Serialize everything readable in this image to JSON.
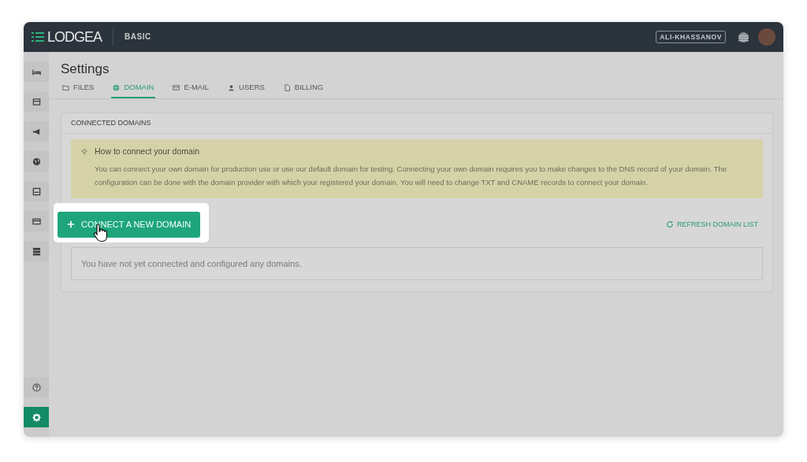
{
  "header": {
    "logo": "LODGEA",
    "plan": "BASIC",
    "user": "ALI-KHASSANOV"
  },
  "sidebar": {
    "items": [
      {
        "selected": false
      },
      {
        "selected": false
      },
      {
        "selected": false
      },
      {
        "selected": false
      },
      {
        "selected": false
      },
      {
        "selected": false
      },
      {
        "selected": false
      }
    ],
    "bottom_items": [
      {
        "selected": false
      },
      {
        "selected": true
      }
    ]
  },
  "page": {
    "title": "Settings"
  },
  "tabs": [
    {
      "label": "FILES",
      "selected": false
    },
    {
      "label": "DOMAIN",
      "selected": true
    },
    {
      "label": "E-MAIL",
      "selected": false
    },
    {
      "label": "USERS",
      "selected": false
    },
    {
      "label": "BILLING",
      "selected": false
    }
  ],
  "card": {
    "title": "CONNECTED DOMAINS",
    "alert": {
      "title": "How to connect your domain",
      "text": "You can connect your own domain for production use or use our default domain for testing. Connecting your own domain requires you to make changes to the DNS record of your domain. The configuration can be done with the domain provider with which your registered your domain. You will need to change TXT and CNAME records to connect your domain."
    },
    "connect_button": "CONNECT A NEW DOMAIN",
    "refresh_link": "REFRESH DOMAIN LIST",
    "empty_message": "You have not yet connected and configured any domains."
  }
}
